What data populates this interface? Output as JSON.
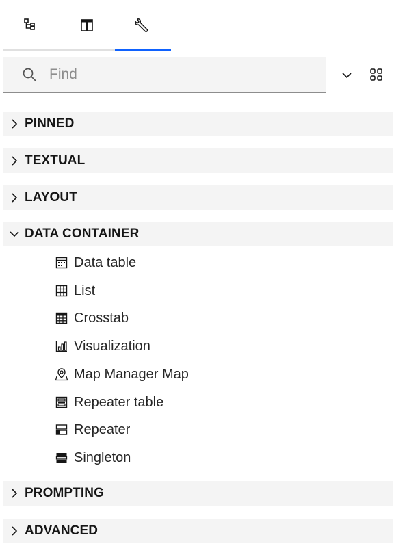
{
  "tabs": [
    {
      "icon": "tree-icon",
      "active": false
    },
    {
      "icon": "template-icon",
      "active": false
    },
    {
      "icon": "toolbox-icon",
      "active": true
    }
  ],
  "search": {
    "placeholder": "Find",
    "value": ""
  },
  "colors": {
    "accent": "#0f62fe",
    "row_background": "#f4f4f4",
    "text": "#161616"
  },
  "categories": {
    "pinned": "PINNED",
    "textual": "TEXTUAL",
    "layout": "LAYOUT",
    "data_container": "DATA CONTAINER",
    "prompting": "PROMPTING",
    "advanced": "ADVANCED"
  },
  "data_container_items": [
    {
      "label": "Data table",
      "icon": "data-table-icon"
    },
    {
      "label": "List",
      "icon": "list-table-icon"
    },
    {
      "label": "Crosstab",
      "icon": "crosstab-icon"
    },
    {
      "label": "Visualization",
      "icon": "visualization-icon"
    },
    {
      "label": "Map Manager Map",
      "icon": "map-pin-icon"
    },
    {
      "label": "Repeater table",
      "icon": "repeater-table-icon"
    },
    {
      "label": "Repeater",
      "icon": "repeater-icon"
    },
    {
      "label": "Singleton",
      "icon": "singleton-icon"
    }
  ]
}
